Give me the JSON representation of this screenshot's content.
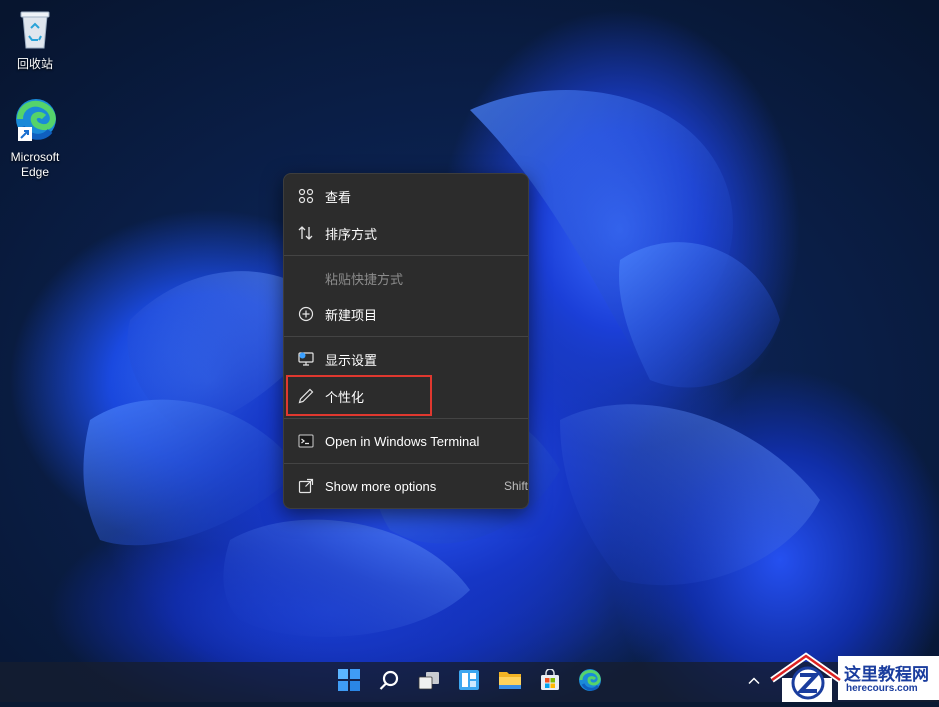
{
  "desktop": {
    "icons": [
      {
        "label": "回收站",
        "icon": "recycle-bin-icon"
      },
      {
        "label": "Microsoft\nEdge",
        "label_line1": "Microsoft",
        "label_line2": "Edge",
        "icon": "edge-icon"
      }
    ]
  },
  "context_menu": {
    "items": [
      {
        "label": "查看",
        "icon": "view-grid-icon",
        "enabled": true
      },
      {
        "label": "排序方式",
        "icon": "sort-arrows-icon",
        "enabled": true
      },
      {
        "label": "粘贴快捷方式",
        "icon": "",
        "enabled": false
      },
      {
        "label": "新建项目",
        "icon": "add-circle-icon",
        "enabled": true
      },
      {
        "label": "显示设置",
        "icon": "display-settings-icon",
        "enabled": true
      },
      {
        "label": "个性化",
        "icon": "pen-icon",
        "enabled": true,
        "highlighted": true
      },
      {
        "label": "Open in Windows Terminal",
        "icon": "terminal-icon",
        "enabled": true
      },
      {
        "label": "Show more options",
        "icon": "open-external-icon",
        "enabled": true,
        "shortcut": "Shift"
      }
    ]
  },
  "taskbar": {
    "items": [
      "start-icon",
      "search-icon",
      "task-view-icon",
      "widgets-icon",
      "file-explorer-icon",
      "store-icon",
      "edge-icon"
    ],
    "tray": [
      "chevron-up-icon"
    ]
  },
  "watermark": {
    "title": "这里教程网",
    "url": "herecours.com"
  },
  "colors": {
    "menu_bg": "#2c2c2c",
    "highlight_box": "#e0382f",
    "accent": "#1d4bff"
  }
}
